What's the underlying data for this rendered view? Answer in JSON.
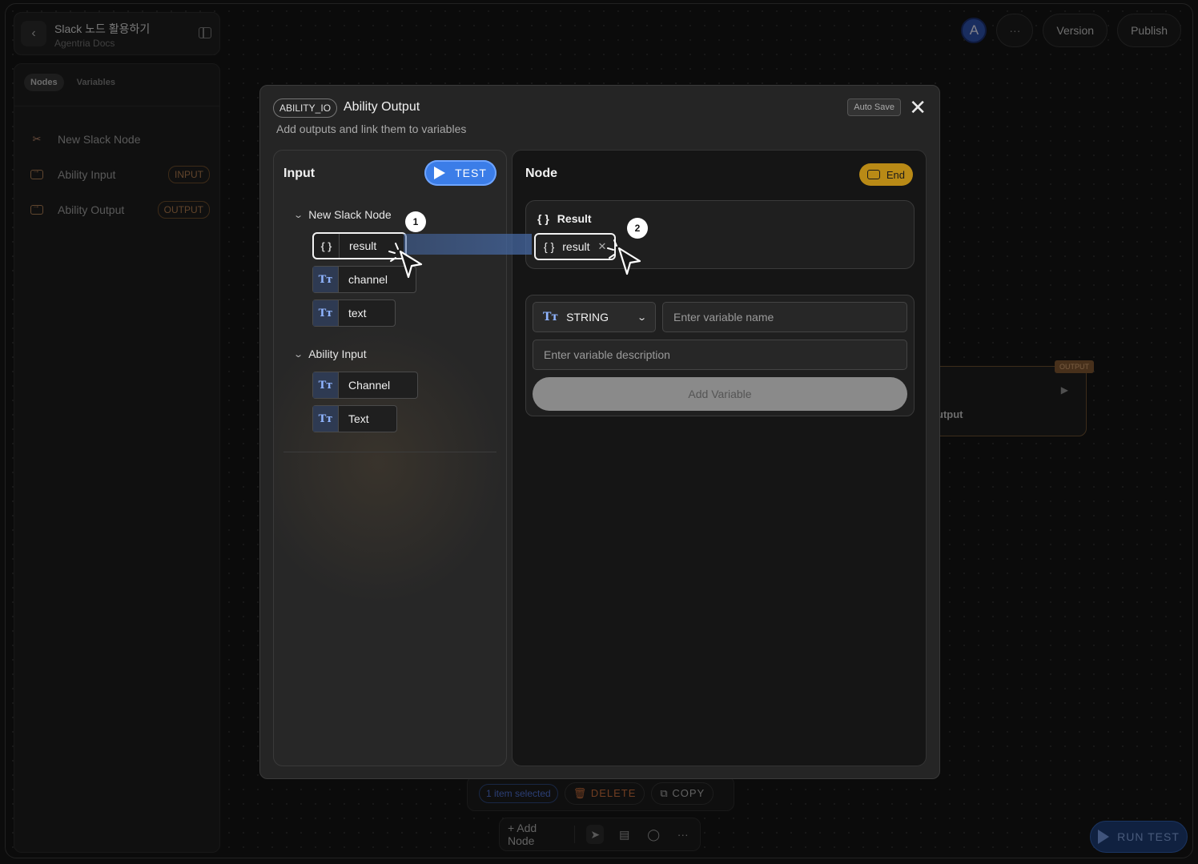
{
  "project": {
    "title": "Slack 노드 활용하기",
    "subtitle": "Agentria Docs"
  },
  "sidebar": {
    "tabs": [
      {
        "label": "Nodes",
        "active": true
      },
      {
        "label": "Variables",
        "active": false
      }
    ],
    "items": [
      {
        "label": "New Slack Node",
        "icon": "tools-icon",
        "badge": ""
      },
      {
        "label": "Ability Input",
        "icon": "io-icon",
        "badge": "INPUT"
      },
      {
        "label": "Ability Output",
        "icon": "io-icon",
        "badge": "OUTPUT"
      }
    ]
  },
  "topbar": {
    "avatar": "A",
    "more": "···",
    "version": "Version",
    "publish": "Publish"
  },
  "canvas_node": {
    "tag": "OUTPUT",
    "name": "utput"
  },
  "selection_bar": {
    "selected": "1 item selected",
    "delete": "DELETE",
    "copy": "COPY"
  },
  "bottom_toolbar": {
    "add_node": "+ Add Node"
  },
  "run_test": "RUN TEST",
  "modal": {
    "tag": "ABILITY_IO",
    "title": "Ability Output",
    "subtitle": "Add outputs and link them to variables",
    "auto_save": "Auto Save",
    "close": "✕",
    "input_panel": {
      "title": "Input",
      "test_label": "TEST",
      "groups": [
        {
          "label": "New Slack Node",
          "vars": [
            {
              "label": "result",
              "type": "object"
            },
            {
              "label": "channel",
              "type": "text"
            },
            {
              "label": "text",
              "type": "text"
            }
          ]
        },
        {
          "label": "Ability Input",
          "vars": [
            {
              "label": "Channel",
              "type": "text"
            },
            {
              "label": "Text",
              "type": "text"
            }
          ]
        }
      ]
    },
    "node_panel": {
      "title": "Node",
      "end_label": "End",
      "result_title": "Result",
      "result_chip": "result",
      "form": {
        "type_value": "STRING",
        "name_placeholder": "Enter variable name",
        "desc_placeholder": "Enter variable description",
        "add_label": "Add Variable"
      }
    },
    "steps": [
      "1",
      "2"
    ]
  }
}
